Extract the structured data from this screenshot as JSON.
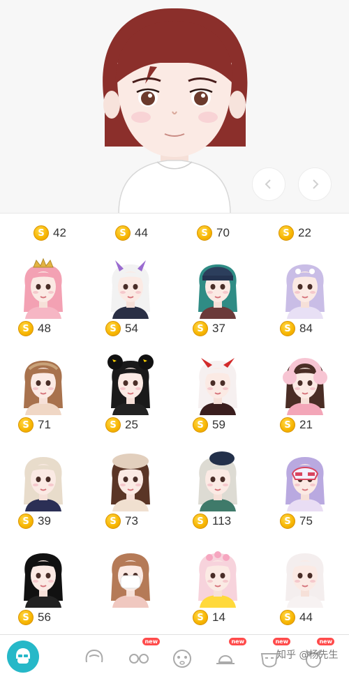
{
  "partial_prices": [
    "42",
    "44",
    "70",
    "22"
  ],
  "avatars": [
    {
      "price": "48",
      "hair": "#f3a1b3",
      "accessory": "crown",
      "outfit": "#f6b6c4"
    },
    {
      "price": "54",
      "hair": "#f2f2f2",
      "accessory": "horns-purple",
      "outfit": "#2a2f45"
    },
    {
      "price": "37",
      "hair": "#2f8c85",
      "accessory": "beanie",
      "outfit": "#6b3a3a"
    },
    {
      "price": "84",
      "hair": "#c9bde6",
      "accessory": "flower",
      "outfit": "#e8e0f5"
    },
    {
      "price": "71",
      "hair": "#a8724d",
      "accessory": "flower-crown",
      "outfit": "#f0d7c5"
    },
    {
      "price": "25",
      "hair": "#1a1a1a",
      "accessory": "mouse-ears",
      "outfit": "#222222"
    },
    {
      "price": "59",
      "hair": "#f6f0f0",
      "accessory": "horns-red",
      "outfit": "#3a1e1e"
    },
    {
      "price": "21",
      "hair": "#4a2d25",
      "accessory": "earmuffs",
      "outfit": "#f3a6b8"
    },
    {
      "price": "39",
      "hair": "#e8dccb",
      "accessory": "none",
      "outfit": "#2b2f55"
    },
    {
      "price": "73",
      "hair": "#5a3526",
      "accessory": "beret",
      "outfit": "#f0e0d0"
    },
    {
      "price": "113",
      "hair": "#dddbd3",
      "accessory": "fascinator",
      "outfit": "#3f7a6a"
    },
    {
      "price": "75",
      "hair": "#b9a9e0",
      "accessory": "mask",
      "outfit": "#e9ddf4"
    },
    {
      "price": "56",
      "hair": "#111111",
      "accessory": "none",
      "outfit": "#222222"
    },
    {
      "price": "",
      "hair": "#b57a57",
      "accessory": "face-mask",
      "outfit": "#f0c8c0"
    },
    {
      "price": "14",
      "hair": "#f7d3dc",
      "accessory": "flower-band",
      "outfit": "#ffd93b"
    },
    {
      "price": "44",
      "hair": "#f4eeee",
      "accessory": "none",
      "outfit": "#f7f2f2"
    }
  ],
  "coin_symbol": "S",
  "tabs": [
    {
      "icon": "face-icon",
      "new": ""
    },
    {
      "icon": "hair-icon",
      "new": ""
    },
    {
      "icon": "glasses-icon",
      "new": "new"
    },
    {
      "icon": "eyes-icon",
      "new": ""
    },
    {
      "icon": "hat-icon",
      "new": "new"
    },
    {
      "icon": "mask-icon",
      "new": "new"
    },
    {
      "icon": "pet-icon",
      "new": "new"
    }
  ],
  "watermark": "知乎 @杨先生",
  "colors": {
    "accent": "#26b8c8",
    "coin": "#f7b500",
    "badge": "#ff4b4b"
  }
}
